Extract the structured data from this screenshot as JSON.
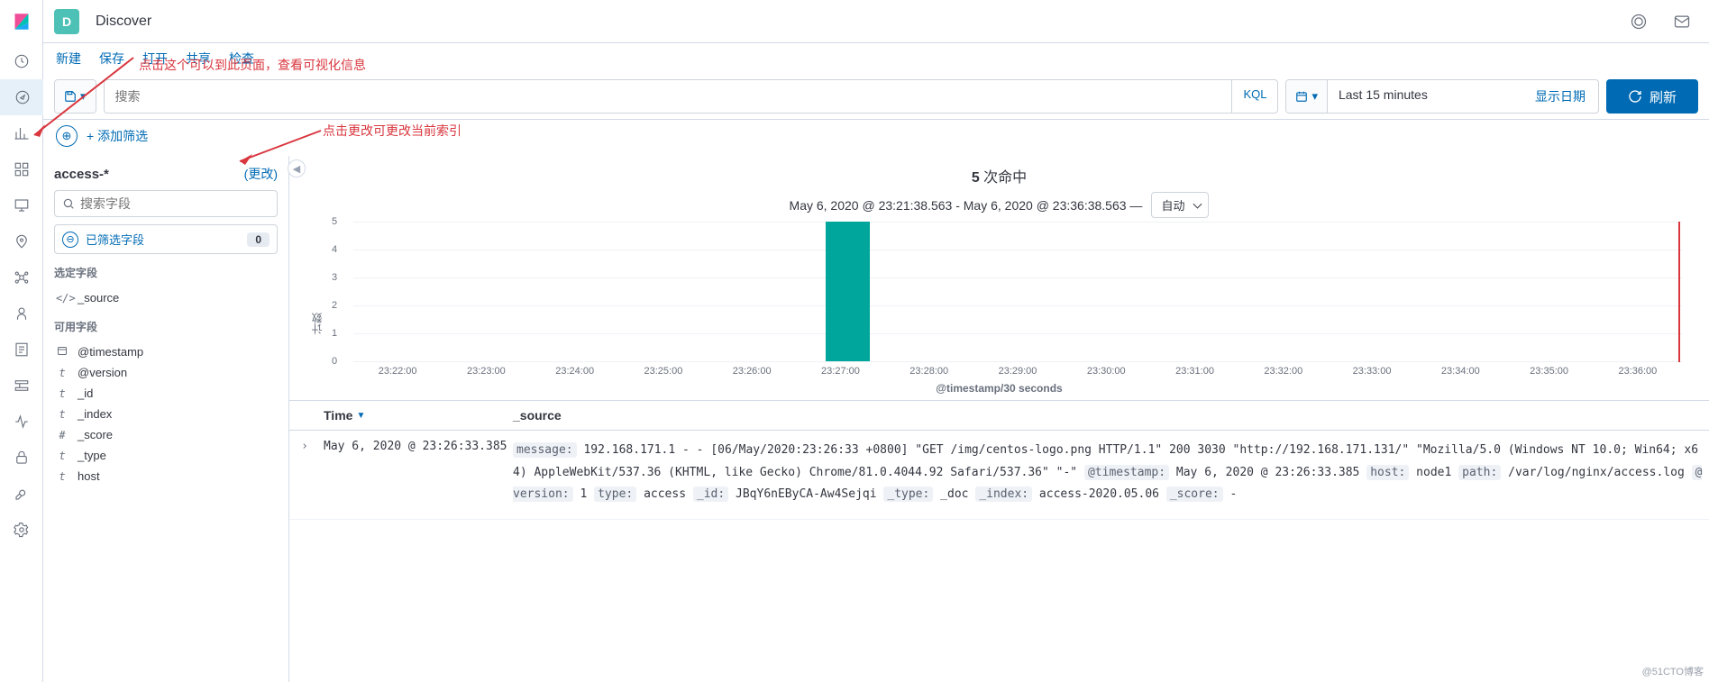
{
  "header": {
    "space_letter": "D",
    "title": "Discover"
  },
  "menu": {
    "new": "新建",
    "save": "保存",
    "open": "打开",
    "share": "共享",
    "inspect": "检查"
  },
  "annotations": {
    "a1": "点击这个可以到此页面，查看可视化信息",
    "a2": "点击更改可更改当前索引"
  },
  "search": {
    "placeholder": "搜索",
    "kql": "KQL",
    "time_value": "Last 15 minutes",
    "show_dates": "显示日期",
    "refresh": "刷新"
  },
  "filter": {
    "add": "+ 添加筛选"
  },
  "sidebar": {
    "index_pattern": "access-*",
    "change": "(更改)",
    "field_search_placeholder": "搜索字段",
    "selected_label": "已筛选字段",
    "selected_count": "0",
    "section_selected": "选定字段",
    "section_available": "可用字段",
    "selected_fields": [
      {
        "type": "</>",
        "name": "_source"
      }
    ],
    "available_fields": [
      {
        "type": "cal",
        "name": "@timestamp"
      },
      {
        "type": "t",
        "name": "@version"
      },
      {
        "type": "t",
        "name": "_id"
      },
      {
        "type": "t",
        "name": "_index"
      },
      {
        "type": "#",
        "name": "_score"
      },
      {
        "type": "t",
        "name": "_type"
      },
      {
        "type": "t",
        "name": "host"
      }
    ]
  },
  "hits": {
    "count": "5",
    "label": "次命中",
    "range": "May 6, 2020 @ 23:21:38.563 - May 6, 2020 @ 23:36:38.563 —",
    "interval": "自动"
  },
  "chart_data": {
    "type": "bar",
    "categories": [
      "23:22:00",
      "23:23:00",
      "23:24:00",
      "23:25:00",
      "23:26:00",
      "23:27:00",
      "23:28:00",
      "23:29:00",
      "23:30:00",
      "23:31:00",
      "23:32:00",
      "23:33:00",
      "23:34:00",
      "23:35:00",
      "23:36:00"
    ],
    "values": [
      0,
      0,
      0,
      0,
      0,
      5,
      0,
      0,
      0,
      0,
      0,
      0,
      0,
      0,
      0
    ],
    "bar_bucket_fraction_start": 0.333,
    "bar_bucket_fraction_width": 0.5,
    "title": "",
    "xlabel": "@timestamp/30 seconds",
    "ylabel": "计数",
    "ylim": [
      0,
      5
    ],
    "yticks": [
      0,
      1,
      2,
      3,
      4,
      5
    ]
  },
  "table": {
    "col_time": "Time",
    "col_source": "_source",
    "rows": [
      {
        "time": "May 6, 2020 @ 23:26:33.385",
        "source_pairs": [
          {
            "k": "message:",
            "v": " 192.168.171.1 - - [06/May/2020:23:26:33 +0800] \"GET /img/centos-logo.png HTTP/1.1\" 200 3030 \"http://192.168.171.131/\" \"Mozilla/5.0 (Windows NT 10.0; Win64; x64) AppleWebKit/537.36 (KHTML, like Gecko) Chrome/81.0.4044.92 Safari/537.36\" \"-\" "
          },
          {
            "k": "@timestamp:",
            "v": " May 6, 2020 @ 23:26:33.385 "
          },
          {
            "k": "host:",
            "v": " node1 "
          },
          {
            "k": "path:",
            "v": " /var/log/nginx/access.log "
          },
          {
            "k": "@version:",
            "v": " 1 "
          },
          {
            "k": "type:",
            "v": " access "
          },
          {
            "k": "_id:",
            "v": " JBqY6nEByCA-Aw4Sejqi "
          },
          {
            "k": "_type:",
            "v": " _doc "
          },
          {
            "k": "_index:",
            "v": " access-2020.05.06 "
          },
          {
            "k": "_score:",
            "v": "  - "
          }
        ]
      }
    ]
  },
  "watermark": "@51CTO博客"
}
